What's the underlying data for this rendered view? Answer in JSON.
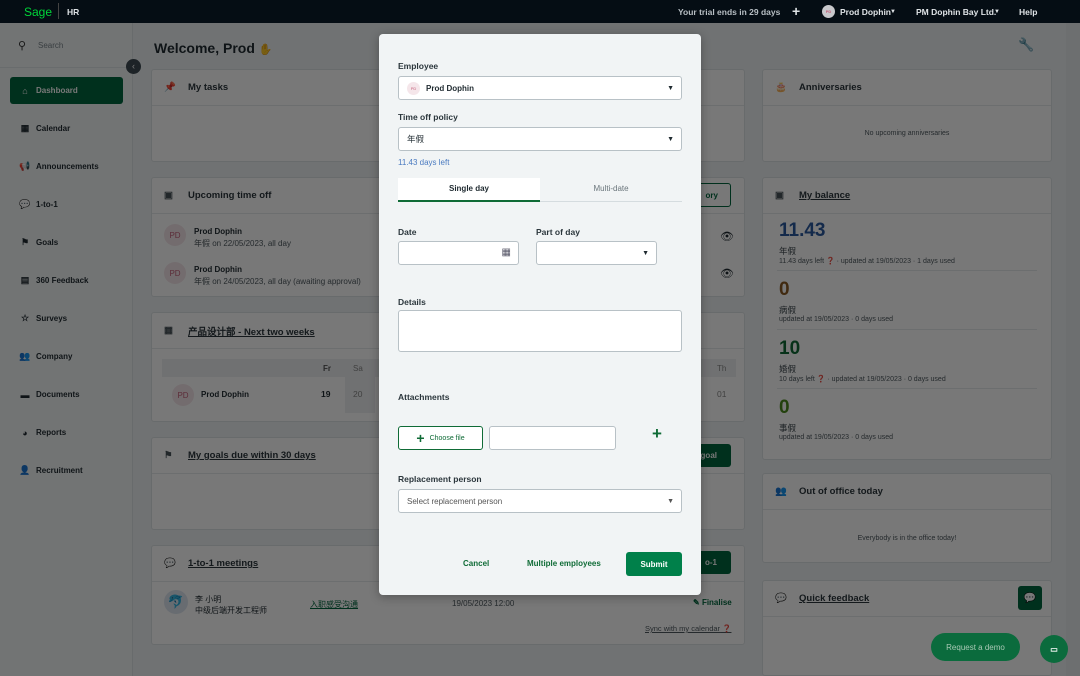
{
  "topbar": {
    "logo": "Sage",
    "product": "HR",
    "trial": "Your trial ends in 29 days",
    "user": "Prod Dophin",
    "user_initials": "PD",
    "company": "PM Dophin Bay Ltd.",
    "help": "Help"
  },
  "sidebar": {
    "search_placeholder": "Search",
    "items": [
      {
        "label": "Dashboard",
        "icon": "home-icon",
        "glyph": "⌂"
      },
      {
        "label": "Calendar",
        "icon": "calendar-icon",
        "glyph": "▦"
      },
      {
        "label": "Announcements",
        "icon": "megaphone-icon",
        "glyph": "📢"
      },
      {
        "label": "1-to-1",
        "icon": "chat-icon",
        "glyph": "💬"
      },
      {
        "label": "Goals",
        "icon": "flag-icon",
        "glyph": "⚑"
      },
      {
        "label": "360 Feedback",
        "icon": "clipboard-icon",
        "glyph": "▤"
      },
      {
        "label": "Surveys",
        "icon": "star-icon",
        "glyph": "☆"
      },
      {
        "label": "Company",
        "icon": "users-icon",
        "glyph": "👥"
      },
      {
        "label": "Documents",
        "icon": "folder-icon",
        "glyph": "▬"
      },
      {
        "label": "Reports",
        "icon": "pie-chart-icon",
        "glyph": "◕"
      },
      {
        "label": "Recruitment",
        "icon": "user-plus-icon",
        "glyph": "👤"
      }
    ]
  },
  "main": {
    "welcome": "Welcome, Prod",
    "tasks": {
      "title": "My tasks"
    },
    "upcoming": {
      "title": "Upcoming time off",
      "button": "ory",
      "items": [
        {
          "initials": "PD",
          "name": "Prod Dophin",
          "detail": "年假 on 22/05/2023, all day"
        },
        {
          "initials": "PD",
          "name": "Prod Dophin",
          "detail": "年假 on 24/05/2023, all day (awaiting approval)"
        }
      ]
    },
    "dept": {
      "title": "产品设计部 - Next two weeks",
      "days": [
        "Fr",
        "Sa",
        "Th"
      ],
      "dates": [
        "19",
        "20",
        "01"
      ],
      "person": {
        "initials": "PD",
        "name": "Prod Dophin"
      }
    },
    "goals": {
      "title": "My goals due within 30 days",
      "button": "goal"
    },
    "meetings": {
      "title": "1-to-1 meetings",
      "button": "o-1",
      "row": {
        "name": "李 小明",
        "role": "中级后端开发工程师",
        "topic": "入职感受沟通",
        "date": "19/05/2023 12:00",
        "action": "Finalise"
      },
      "sync": "Sync with my calendar"
    }
  },
  "right": {
    "anniversaries": {
      "title": "Anniversaries",
      "empty": "No upcoming anniversaries"
    },
    "balance": {
      "title": "My balance",
      "items": [
        {
          "value": "11.43",
          "name": "年假",
          "info": "11.43 days left ❓ · updated at 19/05/2023 · 1 days used",
          "color": "#2a5aa0"
        },
        {
          "value": "0",
          "name": "病假",
          "info": "updated at 19/05/2023 · 0 days used",
          "color": "#8a5a22"
        },
        {
          "value": "10",
          "name": "婚假",
          "info": "10 days left ❓ · updated at 19/05/2023 · 0 days used",
          "color": "#0f6b36"
        },
        {
          "value": "0",
          "name": "事假",
          "info": "updated at 19/05/2023 · 0 days used",
          "color": "#4a8a1c"
        }
      ]
    },
    "ooo": {
      "title": "Out of office today",
      "empty": "Everybody is in the office today!"
    },
    "feedback": {
      "title": "Quick feedback"
    },
    "demo": "Request a demo"
  },
  "modal": {
    "employee_label": "Employee",
    "employee_value": "Prod Dophin",
    "employee_initials": "PD",
    "policy_label": "Time off policy",
    "policy_value": "年假",
    "days_left": "11.43 days left",
    "tabs": [
      "Single day",
      "Multi-date"
    ],
    "date_label": "Date",
    "part_label": "Part of day",
    "details_label": "Details",
    "attachments_label": "Attachments",
    "choose_file": "Choose file",
    "replacement_label": "Replacement person",
    "replacement_placeholder": "Select replacement person",
    "cancel": "Cancel",
    "multiple": "Multiple employees",
    "submit": "Submit"
  }
}
